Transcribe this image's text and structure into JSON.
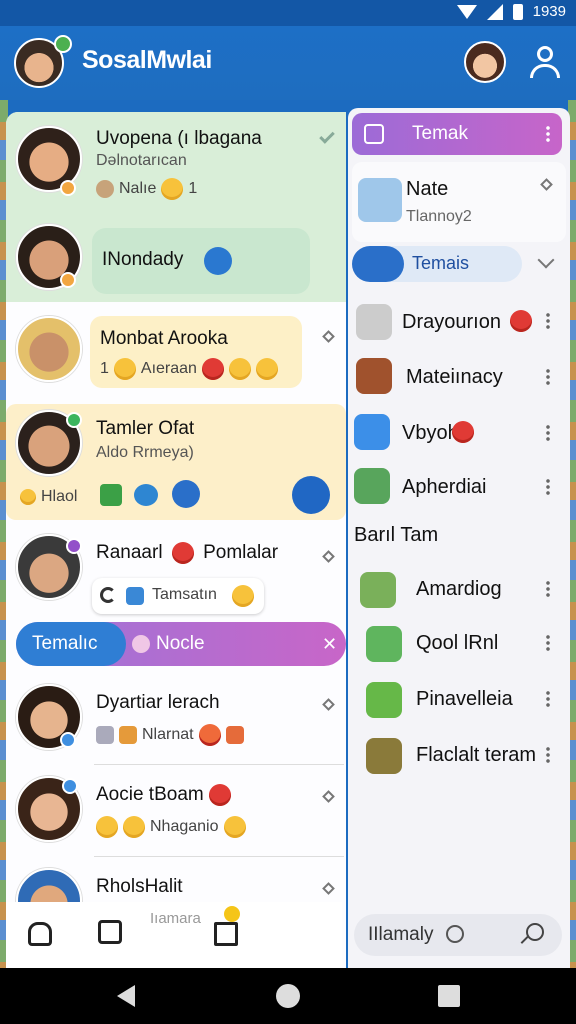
{
  "status": {
    "time": "1939"
  },
  "app": {
    "title": "SosalMwlai"
  },
  "chats": [
    {
      "title": "Uvopena (ı lbagana",
      "sub": "Dəlnotarıcan",
      "meta": "Nalıe",
      "count": "1"
    },
    {
      "pill": "INondady"
    },
    {
      "title": "Monbat Arooka",
      "meta_num": "1",
      "meta": "Aıeraan"
    },
    {
      "title": "Tamler Ofat",
      "sub": "Aldo Rrmeya)",
      "meta": "Hlaol"
    },
    {
      "title": "Ranaarl",
      "title2": "Pomlalar",
      "meta": "Tamsatın"
    },
    {
      "title": "Dyartiar lerach",
      "meta": "Nlarnat"
    },
    {
      "title": "Aocie tBoam",
      "meta": "Nhaganio"
    },
    {
      "title": "RholsHalit",
      "meta": "Iıamara"
    }
  ],
  "filter_tabs": {
    "left": "Temalıc",
    "right": "Nocle"
  },
  "right_panel": {
    "header": "Temak",
    "items": [
      {
        "label": "Nate",
        "sub": "Tlannoy2"
      },
      {
        "label": "Temais"
      },
      {
        "label": "Drayourıon"
      },
      {
        "label": "Mateiınacy"
      },
      {
        "label": "Vbyoh"
      },
      {
        "label": "Apherdiai"
      }
    ],
    "section": "Barıl Tam",
    "section_items": [
      {
        "label": "Amardiog"
      },
      {
        "label": "Qool lRnl"
      },
      {
        "label": "Pinavelleia"
      },
      {
        "label": "Flaclalt teram"
      }
    ]
  },
  "search": {
    "label": "IIlamaly"
  },
  "colors": {
    "appbar": "#1d6fc6",
    "tab_gradient_start": "#3d8ad8",
    "tab_gradient_end": "#c765c9"
  },
  "icons": [
    "wifi-icon",
    "signal-icon",
    "battery-icon",
    "profile-icon",
    "home-icon",
    "search-icon"
  ]
}
